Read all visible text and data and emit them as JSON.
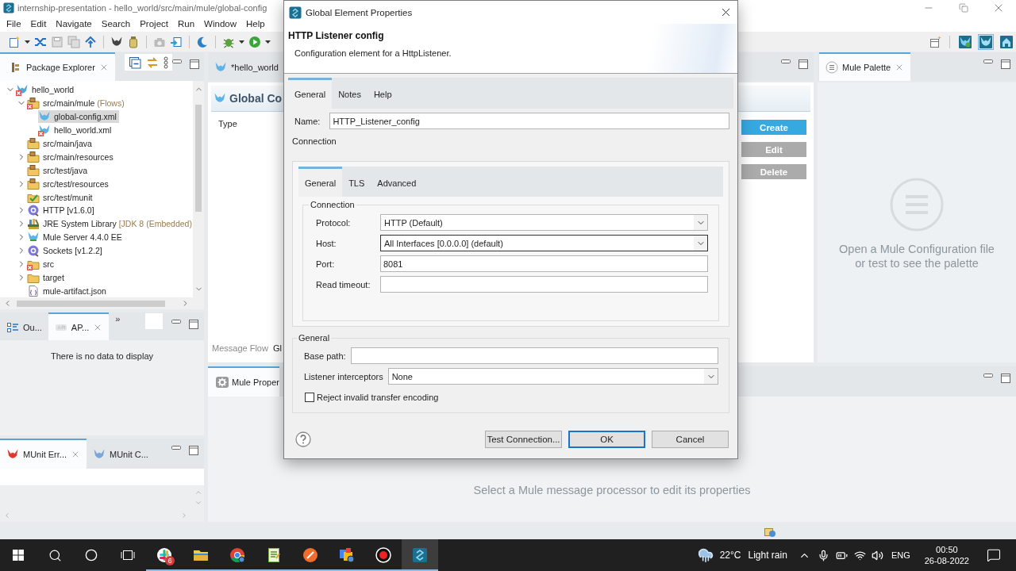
{
  "title_bar": {
    "title": "internship-presentation - hello_world/src/main/mule/global-config"
  },
  "menu_bar": {
    "items": [
      "File",
      "Edit",
      "Navigate",
      "Search",
      "Project",
      "Run",
      "Window",
      "Help"
    ]
  },
  "package_explorer": {
    "tabs": [
      {
        "label": "Package Explorer",
        "selected": true
      }
    ],
    "tree": [
      {
        "label": "hello_world",
        "kind": "project",
        "error": true,
        "expanded": true,
        "selected": false,
        "children": [
          {
            "label": "src/main/mule",
            "note": "(Flows)",
            "kind": "source-folder",
            "error": true,
            "expanded": true,
            "selected": false,
            "children": [
              {
                "label": "global-config.xml",
                "kind": "mule-file",
                "error": false,
                "selected": true
              },
              {
                "label": "hello_world.xml",
                "kind": "mule-file",
                "error": true,
                "selected": false
              }
            ]
          },
          {
            "label": "src/main/java",
            "kind": "source-folder",
            "error": false,
            "selected": false
          },
          {
            "label": "src/main/resources",
            "kind": "source-folder",
            "error": false,
            "expanded": false,
            "selected": false
          },
          {
            "label": "src/test/java",
            "kind": "source-folder",
            "error": false,
            "selected": false
          },
          {
            "label": "src/test/resources",
            "kind": "source-folder",
            "error": false,
            "expanded": false,
            "selected": false
          },
          {
            "label": "src/test/munit",
            "kind": "test-folder",
            "error": false,
            "selected": false
          },
          {
            "label": "HTTP [v1.6.0]",
            "kind": "connector",
            "error": false,
            "expanded": false,
            "selected": false
          },
          {
            "label": "JRE System Library",
            "note": "[JDK 8 (Embedded)",
            "kind": "jre-library",
            "error": false,
            "expanded": false,
            "selected": false
          },
          {
            "label": "Mule Server 4.4.0 EE",
            "kind": "mule-runtime",
            "error": false,
            "expanded": false,
            "selected": false
          },
          {
            "label": "Sockets [v1.2.2]",
            "kind": "connector",
            "error": false,
            "expanded": false,
            "selected": false
          },
          {
            "label": "src",
            "kind": "folder",
            "error": true,
            "expanded": false,
            "selected": false
          },
          {
            "label": "target",
            "kind": "folder",
            "error": false,
            "expanded": false,
            "selected": false
          },
          {
            "label": "mule-artifact.json",
            "kind": "json-file",
            "error": false,
            "selected": false
          }
        ]
      }
    ]
  },
  "outline_pane": {
    "tabs": [
      {
        "label": "Ou...",
        "selected": false
      },
      {
        "label": "AP...",
        "selected": true
      }
    ],
    "overflow": "»",
    "message": "There is no data to display"
  },
  "munit_pane": {
    "tabs": [
      {
        "label": "MUnit Err...",
        "selected": true
      },
      {
        "label": "MUnit C...",
        "selected": false
      }
    ]
  },
  "editor": {
    "tabs": [
      {
        "label": "*hello_world",
        "selected": false
      }
    ],
    "heading": "Global Co",
    "column": "Type",
    "buttons": [
      {
        "label": "Create",
        "disabled": false
      },
      {
        "label": "Edit",
        "disabled": true
      },
      {
        "label": "Delete",
        "disabled": true
      }
    ],
    "bottom_tabs": [
      {
        "label": "Message Flow",
        "selected": false
      },
      {
        "label": "Gl",
        "selected": true
      }
    ]
  },
  "palette": {
    "tabs": [
      {
        "label": "Mule Palette",
        "selected": true
      }
    ],
    "message": "Open a Mule Configuration file or test to see the palette"
  },
  "properties_pane": {
    "tabs": [
      {
        "label": "Mule Proper",
        "selected": true
      }
    ],
    "message": "Select a Mule message processor to edit its properties"
  },
  "dialog": {
    "title": "Global Element Properties",
    "heading": "HTTP Listener config",
    "description": "Configuration element for a HttpListener.",
    "tabs": [
      {
        "label": "General",
        "selected": true
      },
      {
        "label": "Notes",
        "selected": false
      },
      {
        "label": "Help",
        "selected": false
      }
    ],
    "name_field": {
      "label": "Name:",
      "value": "HTTP_Listener_config"
    },
    "section_label": "Connection",
    "connection": {
      "tabs": [
        {
          "label": "General",
          "selected": true
        },
        {
          "label": "TLS",
          "selected": false
        },
        {
          "label": "Advanced",
          "selected": false
        }
      ],
      "group_title": "Connection",
      "fields": [
        {
          "kind": "select",
          "label": "Protocol:",
          "value": "HTTP (Default)",
          "focused": false
        },
        {
          "kind": "select",
          "label": "Host:",
          "value": "All Interfaces [0.0.0.0] (default)",
          "focused": true
        },
        {
          "kind": "text",
          "label": "Port:",
          "value": "8081",
          "focused": false
        },
        {
          "kind": "text",
          "label": "Read timeout:",
          "focused": false
        }
      ]
    },
    "general": {
      "group_title": "General",
      "fields": [
        {
          "kind": "text",
          "label": "Base path:",
          "focused": false
        },
        {
          "kind": "select",
          "label": "Listener interceptors",
          "value": "None",
          "focused": false
        }
      ],
      "checkbox": {
        "label": "Reject invalid transfer encoding",
        "checked": false
      }
    },
    "buttons": [
      {
        "label": "Test Connection...",
        "default": false
      },
      {
        "label": "OK",
        "default": true
      },
      {
        "label": "Cancel",
        "default": false
      }
    ]
  },
  "taskbar": {
    "apps": [
      {
        "kind": "chat",
        "badge": "6",
        "active": false
      },
      {
        "kind": "files",
        "active": false
      },
      {
        "kind": "browser",
        "active": false
      },
      {
        "kind": "notepad",
        "active": false
      },
      {
        "kind": "api-client",
        "active": false
      },
      {
        "kind": "workspace",
        "active": false
      },
      {
        "kind": "recorder",
        "active": false
      },
      {
        "kind": "studio",
        "active": true
      }
    ],
    "weather": {
      "temperature": "22°C",
      "condition": "Light rain"
    },
    "language": "ENG",
    "time": "00:50",
    "date": "26-08-2022"
  }
}
